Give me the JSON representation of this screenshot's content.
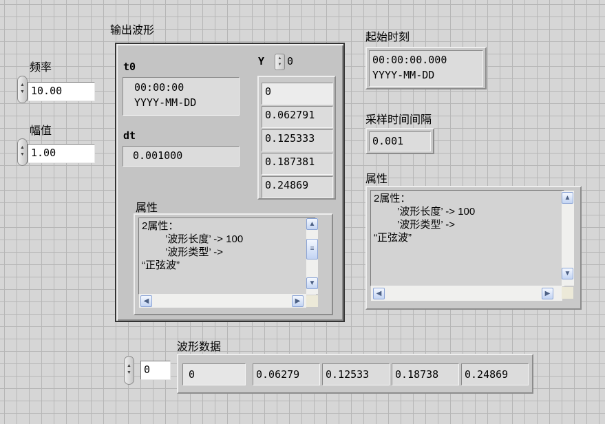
{
  "freq": {
    "label": "频率",
    "value": "10.00"
  },
  "amp": {
    "label": "幅值",
    "value": "1.00"
  },
  "output": {
    "title": "输出波形",
    "t0_label": "t0",
    "t0_value": "00:00:00",
    "t0_date": "YYYY-MM-DD",
    "dt_label": "dt",
    "dt_value": "0.001000",
    "y_label": "Y",
    "y_index": "0",
    "y_values": [
      "0",
      "0.062791",
      "0.125333",
      "0.187381",
      "0.24869"
    ],
    "attr_label": "属性",
    "attr_lines": [
      "2属性：",
      "’波形长度’ -> 100",
      "’波形类型’ ->",
      "“正弦波”"
    ]
  },
  "start_time": {
    "label": "起始时刻",
    "time": "00:00:00.000",
    "date": "YYYY-MM-DD"
  },
  "sample_interval": {
    "label": "采样时间间隔",
    "value": "0.001"
  },
  "attr": {
    "label": "属性",
    "lines": [
      "2属性：",
      "’波形长度’ -> 100",
      "’波形类型’ ->",
      "“正弦波”"
    ]
  },
  "waveform_data": {
    "label": "波形数据",
    "index": "0",
    "values": [
      "0",
      "0.06279",
      "0.12533",
      "0.18738",
      "0.24869"
    ]
  },
  "colors": {
    "bg": "#d6d6d6",
    "grid": "#b6b6b6",
    "scroll_btn": "#c3d4f3"
  }
}
